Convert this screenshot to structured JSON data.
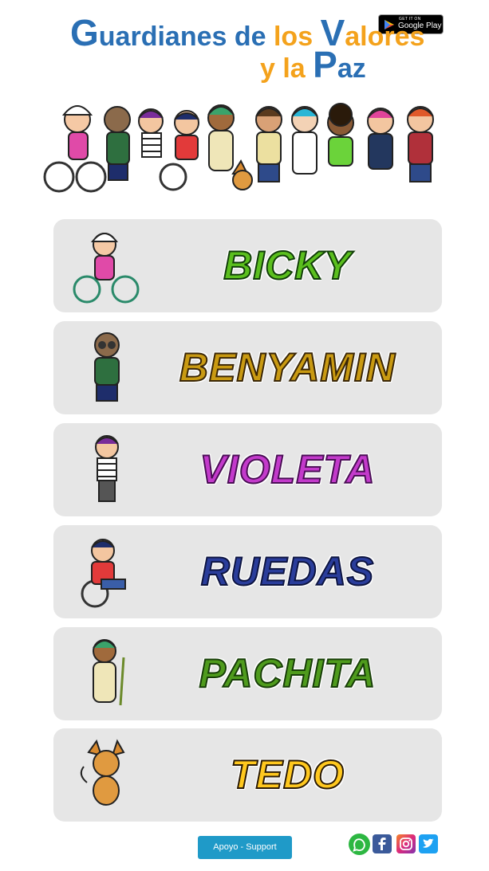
{
  "header": {
    "store_badge": {
      "small": "GET IT ON",
      "big": "Google Play",
      "icon": "google-play-icon"
    },
    "title": {
      "w1_cap": "G",
      "w1_rest": "uardianes",
      "w2": " de ",
      "w3": "los ",
      "w4_cap": "V",
      "w4_rest": "alores",
      "w5": "y ",
      "w6": "la ",
      "w7_cap": "P",
      "w7_rest": "az"
    },
    "banner_icon": "characters-group-illustration"
  },
  "characters": [
    {
      "name": "BICKY",
      "icon": "bicky-character-icon"
    },
    {
      "name": "BENYAMIN",
      "icon": "benyamin-character-icon"
    },
    {
      "name": "VIOLETA",
      "icon": "violeta-character-icon"
    },
    {
      "name": "RUEDAS",
      "icon": "ruedas-character-icon"
    },
    {
      "name": "PACHITA",
      "icon": "pachita-character-icon"
    },
    {
      "name": "TEDO",
      "icon": "tedo-character-icon"
    }
  ],
  "footer": {
    "support_label": "Apoyo - Support",
    "social": [
      "whatsapp-icon",
      "facebook-icon",
      "instagram-icon",
      "twitter-icon"
    ]
  },
  "colors": {
    "blue": "#2a6fb4",
    "orange": "#f4a21c",
    "card_bg": "#e6e6e6",
    "button": "#1f9ac8"
  }
}
